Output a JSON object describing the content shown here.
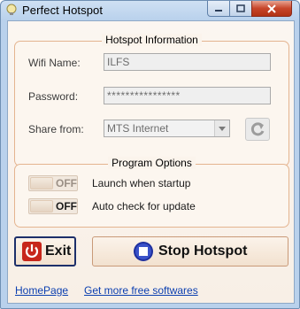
{
  "window": {
    "title": "Perfect Hotspot",
    "icon": "bulb-icon",
    "controls": [
      "minimize-icon",
      "maximize-icon",
      "close-icon"
    ]
  },
  "hotspot_info": {
    "title": "Hotspot Information",
    "wifi_name_label": "Wifi Name:",
    "wifi_name_value": "ILFS",
    "password_label": "Password:",
    "password_value": "****************",
    "share_from_label": "Share from:",
    "share_from_value": "MTS Internet",
    "refresh_icon": "refresh-icon"
  },
  "program_options": {
    "title": "Program Options",
    "options": [
      {
        "state": "OFF",
        "label": "Launch when startup"
      },
      {
        "state": "OFF",
        "label": "Auto check for update"
      }
    ]
  },
  "actions": {
    "exit_label": "Exit",
    "exit_icon": "power-icon",
    "stop_label": "Stop Hotspot",
    "stop_icon": "stop-icon"
  },
  "footer": {
    "homepage_link": "HomePage",
    "more_link": "Get more free softwares"
  },
  "colors": {
    "frame": "#b9d1ec",
    "panel": "#fbf4ec",
    "group_border": "#e4b48f",
    "exit_red": "#c7261b",
    "stop_blue": "#1e2f9e",
    "link": "#0b3fb0"
  }
}
